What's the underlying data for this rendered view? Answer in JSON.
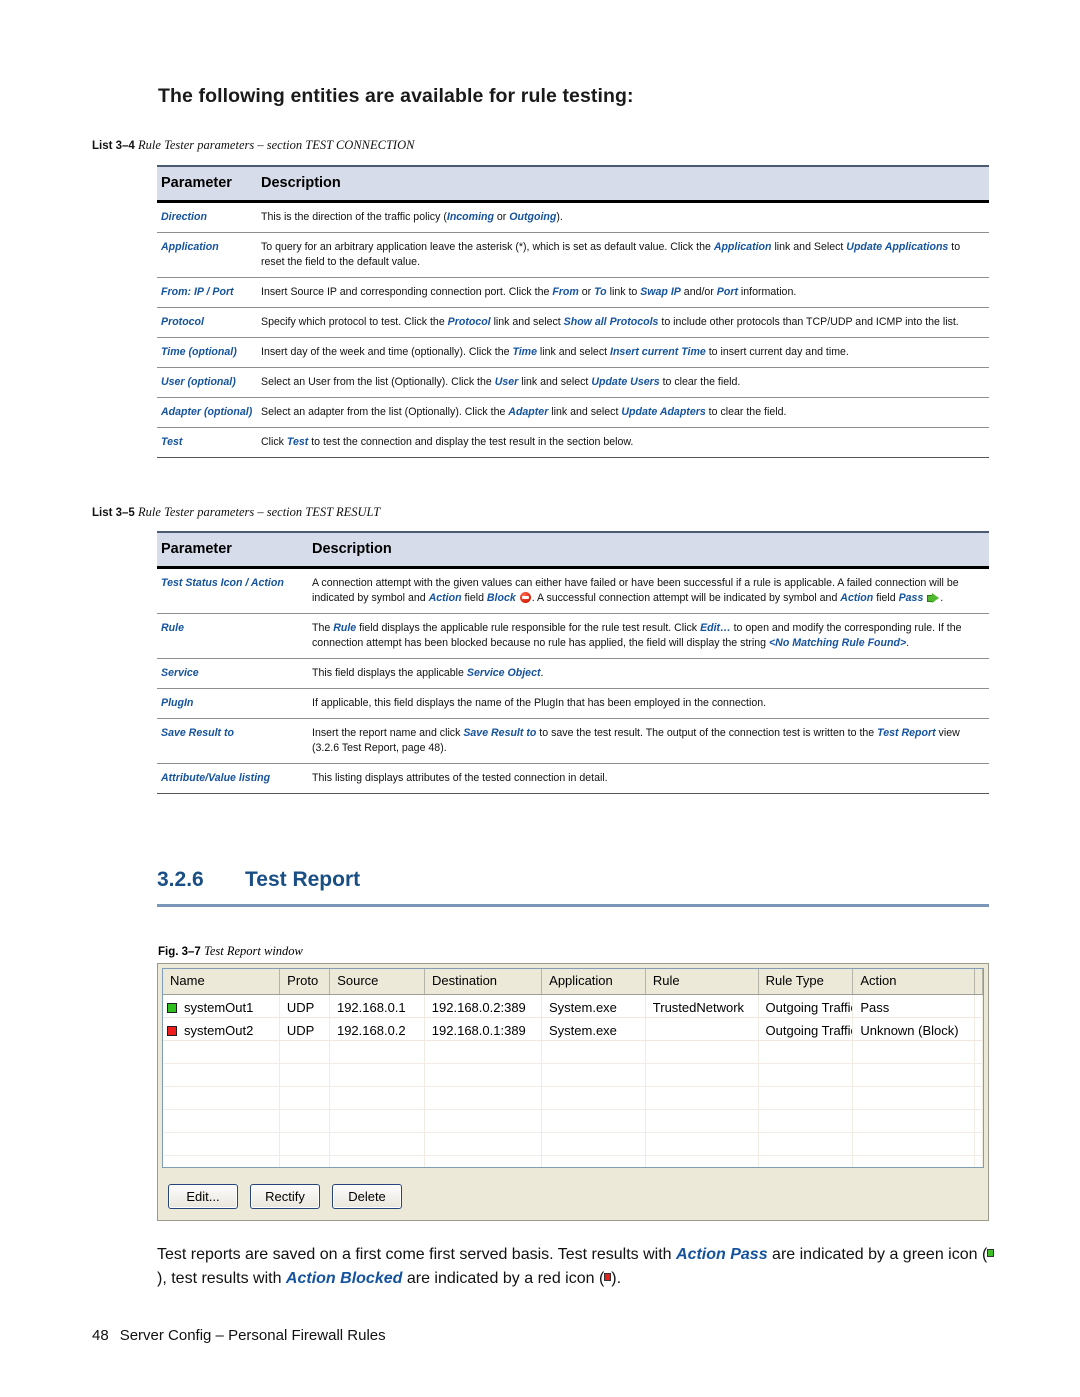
{
  "intro": {
    "heading": "The following entities are available for rule testing:"
  },
  "list_3_4": {
    "caption_label": "List 3–4",
    "caption_text": "Rule Tester parameters – section TEST CONNECTION",
    "columns": {
      "parameter": "Parameter",
      "description": "Description"
    },
    "rows": [
      {
        "parameter": "Direction",
        "description_html": "This is the direction of the traffic policy (<i>Incoming</i> or <i>Outgoing</i>)."
      },
      {
        "parameter": "Application",
        "description_html": "To query for an arbitrary application leave the asterisk (*), which is set as default value. Click the <i>Application</i> link and Select <i>Update Applications</i> to reset the field to the default value."
      },
      {
        "parameter": "From: IP / Port",
        "description_html": "Insert Source IP and corresponding connection port. Click the <i>From</i> or <i>To</i> link to <i>Swap IP</i> and/or <i>Port</i> information."
      },
      {
        "parameter": "Protocol",
        "description_html": "Specify which protocol to test. Click the <i>Protocol</i> link and select <i>Show all Protocols</i> to include other protocols than TCP/UDP and ICMP into the list."
      },
      {
        "parameter": "Time (optional)",
        "description_html": "Insert day of the week and time (optionally). Click the <i>Time</i> link and select <i>Insert current Time</i> to insert current day and time."
      },
      {
        "parameter": "User (optional)",
        "description_html": "Select an User from the list (Optionally). Click the <i>User</i> link and select <i>Update Users</i> to clear the field."
      },
      {
        "parameter": "Adapter (optional)",
        "description_html": "Select an adapter from the list (Optionally). Click the <i>Adapter</i> link and select <i>Update Adapters</i> to clear the field."
      },
      {
        "parameter": "Test",
        "description_html": "Click <i>Test</i> to test the connection and display the test result in the section below."
      }
    ]
  },
  "list_3_5": {
    "caption_label": "List 3–5",
    "caption_text": "Rule Tester parameters – section TEST RESULT",
    "columns": {
      "parameter": "Parameter",
      "description": "Description"
    },
    "rows": [
      {
        "parameter": "Test Status Icon / Action",
        "description_html": "A connection attempt with the given values can either have failed or have been successful if a rule is applicable. A failed connection will be indicated by symbol and <i>Action</i> field <i>Block</i> <span class=\"ic-block\"></span>. A successful connection attempt will be indicated by symbol and <i>Action</i> field <i>Pass</i> <span class=\"ic-pass\"></span>."
      },
      {
        "parameter": "Rule",
        "description_html": "The <i>Rule</i> field displays the applicable rule responsible for the rule test result. Click <i>Edit…</i> to open and modify the corresponding rule. If the connection attempt has been blocked because no rule has applied, the field will display the string <i>&lt;No Matching Rule Found&gt;</i>."
      },
      {
        "parameter": "Service",
        "description_html": "This field displays the applicable <i>Service Object</i>."
      },
      {
        "parameter": "PlugIn",
        "description_html": "If applicable, this field displays the name of the PlugIn that has been employed in the connection."
      },
      {
        "parameter": "Save Result to",
        "description_html": "Insert the report name and click <i>Save Result to</i> to save the test result. The output of the connection test is written to the <i>Test Report</i> view (3.2.6 Test Report, page 48)."
      },
      {
        "parameter": "Attribute/Value listing",
        "description_html": "This listing displays attributes of the tested connection in detail."
      }
    ]
  },
  "section": {
    "number": "3.2.6",
    "title": "Test Report"
  },
  "figure": {
    "caption_label": "Fig. 3–7",
    "caption_text": "Test Report window"
  },
  "test_report_window": {
    "columns": [
      "Name",
      "Proto",
      "Source",
      "Destination",
      "Application",
      "Rule",
      "Rule Type",
      "Action"
    ],
    "rows": [
      {
        "status_icon": "green-square-icon",
        "name": "systemOut1",
        "proto": "UDP",
        "source": "192.168.0.1",
        "destination": "192.168.0.2:389",
        "application": "System.exe",
        "rule": "TrustedNetwork",
        "rule_type": "Outgoing Traffic",
        "action": "Pass"
      },
      {
        "status_icon": "red-square-icon",
        "name": "systemOut2",
        "proto": "UDP",
        "source": "192.168.0.2",
        "destination": "192.168.0.1:389",
        "application": "System.exe",
        "rule": "",
        "rule_type": "Outgoing Traffic",
        "action": "Unknown (Block)"
      }
    ],
    "buttons": [
      "Edit...",
      "Rectify",
      "Delete"
    ]
  },
  "closing": {
    "paragraph_html": "Test reports are saved on a first come first served basis. Test results with <i>Action Pass</i> are indicated by a green icon (<span class=\"mini-green\"></span>), test results with <i>Action Blocked</i> are indicated by a red icon (<span class=\"mini-red\"></span>)."
  },
  "footer": {
    "page_number": "48",
    "text": "Server Config – Personal Firewall Rules"
  },
  "colors": {
    "link_blue": "#15539e",
    "heading_blue": "#1a4f86",
    "rule_blue": "#7b96b8",
    "table_header_bg": "#d7dcea",
    "window_chrome": "#ece9d8",
    "status_green": "#2fc01f",
    "status_red": "#ee1c1c"
  }
}
